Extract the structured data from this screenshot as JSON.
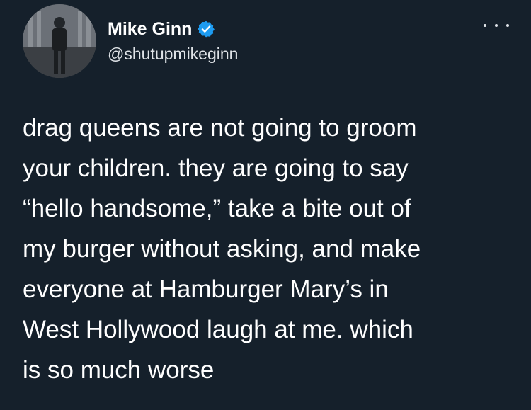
{
  "tweet": {
    "display_name": "Mike Ginn",
    "handle": "@shutupmikeginn",
    "verified": true,
    "text": "drag queens are not going to groom\nyour children. they are going to say\n“hello handsome,” take a bite out of\nmy burger without asking, and make\neveryone at Hamburger Mary’s in\nWest Hollywood laugh at me. which\nis so much worse"
  },
  "colors": {
    "background": "#15202b",
    "text": "#ffffff",
    "secondary_text": "#dfe3e7",
    "verified_badge": "#1d9bf0"
  },
  "icons": {
    "verified": "verified-badge-icon",
    "more": "more-options-icon"
  }
}
